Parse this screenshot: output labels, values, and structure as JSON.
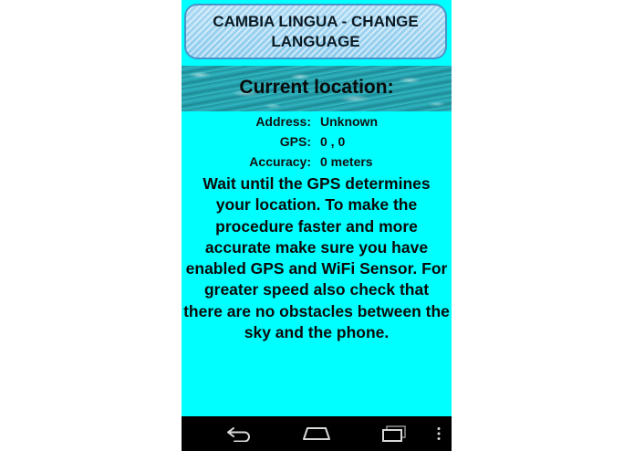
{
  "header": {
    "change_language_label": "CAMBIA LINGUA - CHANGE LANGUAGE"
  },
  "banner": {
    "title": "Current location:"
  },
  "location": {
    "address_label": "Address:",
    "address_value": "Unknown",
    "gps_label": "GPS:",
    "gps_value": "0 , 0",
    "accuracy_label": "Accuracy:",
    "accuracy_value": "0 meters"
  },
  "message": "Wait until the GPS determines your location. To make the procedure faster and more accurate make sure you have enabled GPS and WiFi Sensor. For greater speed also check that there are no obstacles between the sky and the phone.",
  "navbar": {
    "icons": [
      "back-icon",
      "home-icon",
      "recent-apps-icon",
      "overflow-menu-icon"
    ]
  },
  "colors": {
    "screen_background": "#00ffff",
    "button_background": "#9fd4f1",
    "button_border": "#4a93c9",
    "navbar_background": "#000000"
  }
}
